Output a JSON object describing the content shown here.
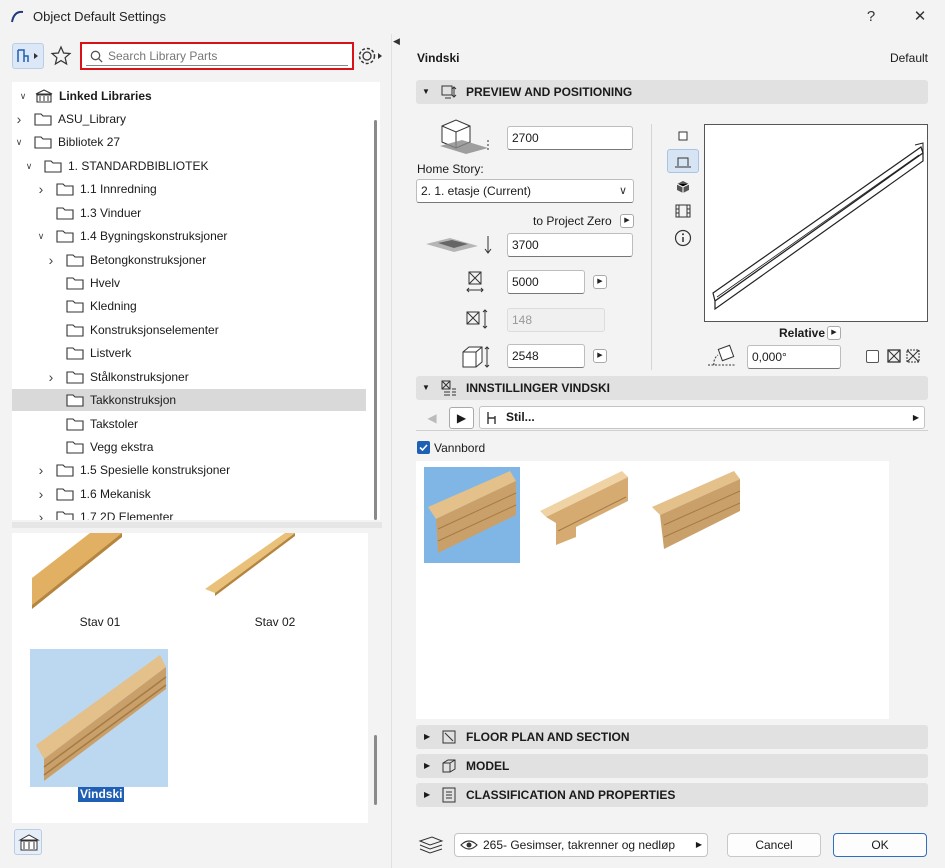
{
  "window": {
    "title": "Object Default Settings",
    "help": "?",
    "close": "✕"
  },
  "search": {
    "placeholder": "Search Library Parts"
  },
  "tree": {
    "root": "Linked Libraries",
    "items": [
      {
        "label": "ASU_Library"
      },
      {
        "label": "Bibliotek 27"
      },
      {
        "label": "1. STANDARDBIBLIOTEK"
      },
      {
        "label": "1.1 Innredning"
      },
      {
        "label": "1.3 Vinduer"
      },
      {
        "label": "1.4 Bygningskonstruksjoner"
      },
      {
        "label": "Betongkonstruksjoner"
      },
      {
        "label": "Hvelv"
      },
      {
        "label": "Kledning"
      },
      {
        "label": "Konstruksjonselementer"
      },
      {
        "label": "Listverk"
      },
      {
        "label": "Stålkonstruksjoner"
      },
      {
        "label": "Takkonstruksjon"
      },
      {
        "label": "Takstoler"
      },
      {
        "label": "Vegg ekstra"
      },
      {
        "label": "1.5 Spesielle konstruksjoner"
      },
      {
        "label": "1.6 Mekanisk"
      },
      {
        "label": "1.7 2D Elementer"
      }
    ]
  },
  "library_items": [
    {
      "label": "Stav 01"
    },
    {
      "label": "Stav 02"
    },
    {
      "label": "Vindski"
    }
  ],
  "header": {
    "object_name": "Vindski",
    "default_label": "Default"
  },
  "preview": {
    "section_title": "PREVIEW AND POSITIONING",
    "elevation_value": "2700",
    "home_story_label": "Home Story:",
    "home_story_value": "2. 1. etasje (Current)",
    "to_project_zero": "to Project Zero",
    "project_zero_value": "3700",
    "width_value": "5000",
    "depth_value": "148",
    "height_value": "2548",
    "relative_label": "Relative",
    "angle_value": "0,000°"
  },
  "settings": {
    "section_title": "INNSTILLINGER VINDSKI",
    "style_label": "Stil...",
    "vannbord_label": "Vannbord"
  },
  "sections": {
    "floor_plan": "FLOOR PLAN AND SECTION",
    "model": "MODEL",
    "classification": "CLASSIFICATION AND PROPERTIES"
  },
  "footer": {
    "layer_value": "265- Gesimser, takrenner og nedløp",
    "cancel": "Cancel",
    "ok": "OK"
  },
  "colors": {
    "accent": "#1f5fb4",
    "selection": "#cde4f7",
    "search_highlight": "#d9121a"
  }
}
